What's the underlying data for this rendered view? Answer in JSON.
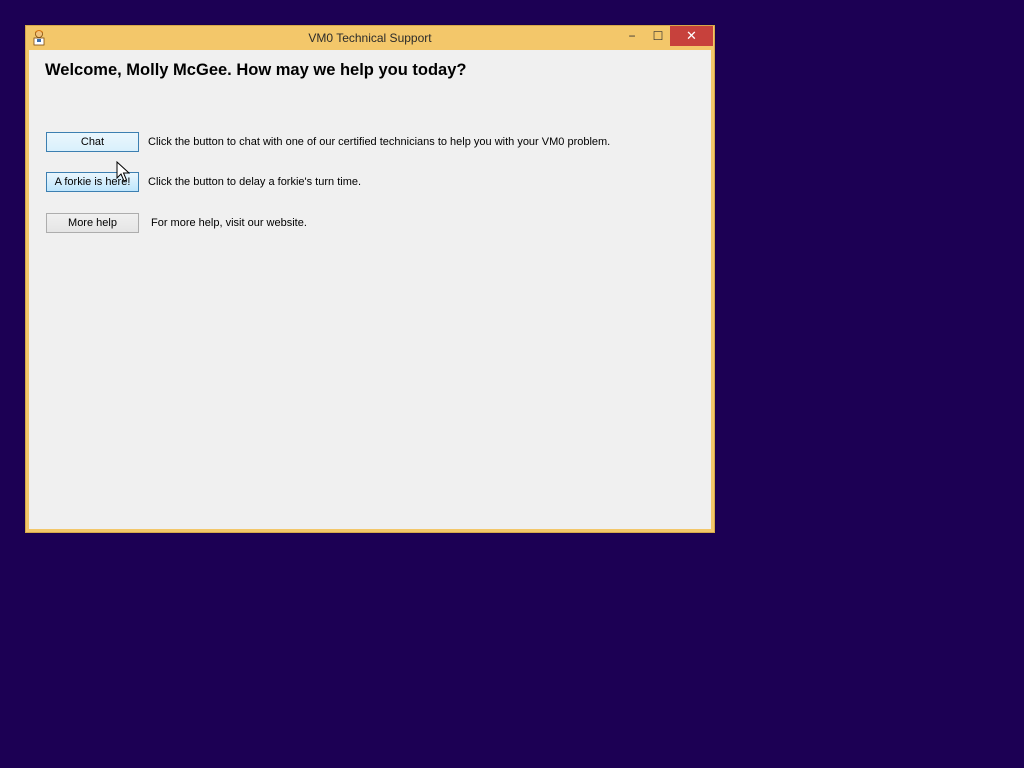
{
  "window": {
    "title": "VM0 Technical Support",
    "controls": {
      "minimize_glyph": "−",
      "maximize_glyph": "☐",
      "close_glyph": "✕"
    },
    "app_icon": "technician-icon"
  },
  "content": {
    "welcome": "Welcome, Molly McGee. How may we help you today?",
    "rows": [
      {
        "button_label": "Chat",
        "description": "Click the button to chat with one of our certified technicians to help you with your VM0 problem."
      },
      {
        "button_label": "A forkie is here!",
        "description": "Click the button to delay a forkie's turn time."
      },
      {
        "button_label": "More help",
        "description": "For more help, visit our website."
      }
    ]
  },
  "colors": {
    "desktop": "#1c0054",
    "titlebar": "#f3c76a",
    "close_button": "#c7413c",
    "client": "#f0f0f0"
  },
  "cursor": "arrow-cursor-icon"
}
